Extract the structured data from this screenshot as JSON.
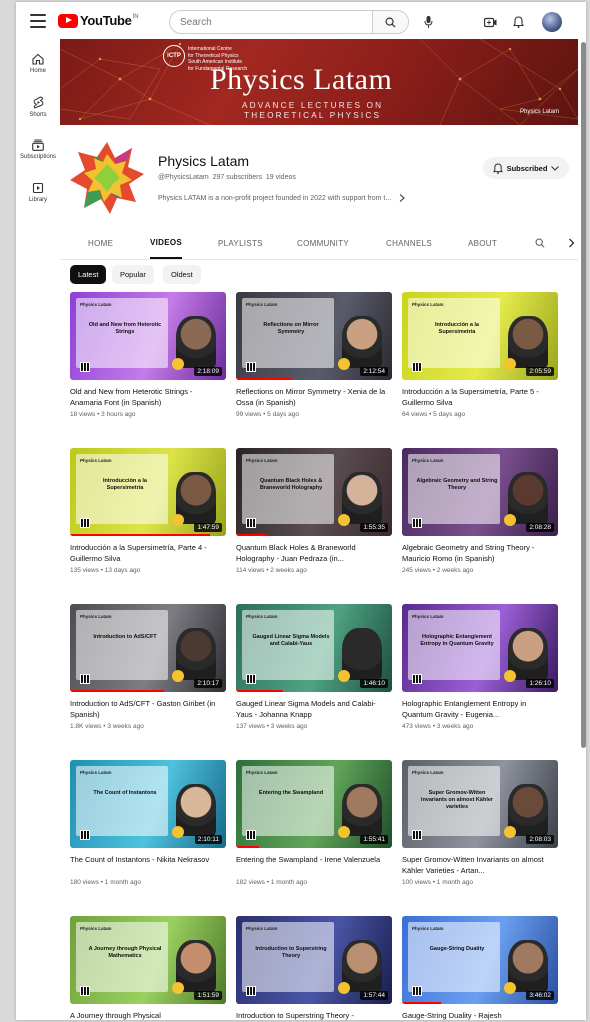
{
  "header": {
    "logo_text": "YouTube",
    "logo_region": "IN",
    "search_placeholder": "Search"
  },
  "sidebar": {
    "items": [
      {
        "label": "Home",
        "icon": "home-icon"
      },
      {
        "label": "Shorts",
        "icon": "shorts-icon"
      },
      {
        "label": "Subscriptions",
        "icon": "subscriptions-icon"
      },
      {
        "label": "Library",
        "icon": "library-icon"
      }
    ]
  },
  "banner": {
    "org_line1": "International Centre",
    "org_line2": "for Theoretical Physics",
    "org_line3": "South American Institute",
    "org_line4": "for Fundamental Research",
    "logo_text": "ICTP",
    "title": "Physics Latam",
    "subtitle_line1": "ADVANCE LECTURES ON",
    "subtitle_line2": "THEORETICAL PHYSICS",
    "badge": "Physics Latam"
  },
  "channel": {
    "name": "Physics Latam",
    "handle": "@PhysicsLatam",
    "subscribers": "297 subscribers",
    "videos_count": "19 videos",
    "description": "Physics LATAM is a non-profit project founded in 2022 with support from t...",
    "subscribe_label": "Subscribed"
  },
  "tabs": [
    "HOME",
    "VIDEOS",
    "PLAYLISTS",
    "COMMUNITY",
    "CHANNELS",
    "ABOUT"
  ],
  "active_tab": "VIDEOS",
  "chips": [
    "Latest",
    "Popular",
    "Oldest"
  ],
  "videos": [
    {
      "title": "Old and New from Heterotic Strings - Anamaria Font (in Spanish)",
      "meta": "18 views • 3 hours ago",
      "duration": "2:18:09",
      "thumb_title": "Old and New from Heterotic Strings"
    },
    {
      "title": "Reflections on Mirror Symmetry - Xenia de la Ossa (in Spanish)",
      "meta": "99 views • 5 days ago",
      "duration": "2:12:54",
      "thumb_title": "Reflections on Mirror Symmetry"
    },
    {
      "title": "Introducción a la Supersimetría, Parte 5 - Guillermo Silva",
      "meta": "64 views • 5 days ago",
      "duration": "2:05:59",
      "thumb_title": "Introducción a la Supersimetría"
    },
    {
      "title": "Introducción a la Supersimetría, Parte 4 - Guillermo Silva",
      "meta": "135 views • 13 days ago",
      "duration": "1:47:59",
      "thumb_title": "Introducción a la Supersimetría"
    },
    {
      "title": "Quantum Black Holes & Braneworld Holography - Juan Pedraza (in...",
      "meta": "114 views • 2 weeks ago",
      "duration": "1:55:35",
      "thumb_title": "Quantum Black Holes & Braneworld Holography"
    },
    {
      "title": "Algebraic Geometry and String Theory - Mauricio Romo (in Spanish)",
      "meta": "245 views • 2 weeks ago",
      "duration": "2:08:28",
      "thumb_title": "Algebraic Geometry and String Theory"
    },
    {
      "title": "Introduction to AdS/CFT - Gaston Giribet (in Spanish)",
      "meta": "1.8K views • 3 weeks ago",
      "duration": "2:10:17",
      "thumb_title": "Introduction to AdS/CFT"
    },
    {
      "title": "Gauged Linear Sigma Models and Calabi-Yaus - Johanna Knapp",
      "meta": "137 views • 3 weeks ago",
      "duration": "1:46:10",
      "thumb_title": "Gauged Linear Sigma Models and Calabi-Yaus"
    },
    {
      "title": "Holographic Entanglement Entropy in Quantum Gravity - Eugenia...",
      "meta": "473 views • 3 weeks ago",
      "duration": "1:26:10",
      "thumb_title": "Holographic Entanglement Entropy in Quantum Gravity"
    },
    {
      "title": "The Count of Instantons - Nikita Nekrasov",
      "meta": "180 views • 1 month ago",
      "duration": "2:10:11",
      "thumb_title": "The Count of Instantons"
    },
    {
      "title": "Entering the Swampland - Irene Valenzuela",
      "meta": "182 views • 1 month ago",
      "duration": "1:55:41",
      "thumb_title": "Entering the Swampland"
    },
    {
      "title": "Super Gromov-Witten Invariants on almost Kähler Varieties - Artan...",
      "meta": "100 views • 1 month ago",
      "duration": "2:08:03",
      "thumb_title": "Super Gromov-Witten invariants on almost Kähler varieties"
    },
    {
      "title": "A Journey through Physical",
      "meta": "",
      "duration": "1:51:59",
      "thumb_title": "A Journey through Physical Mathematics"
    },
    {
      "title": "Introduction to Superstring Theory -",
      "meta": "",
      "duration": "1:57:44",
      "thumb_title": "Introduction to Superstring Theory"
    },
    {
      "title": "Gauge-String Duality - Rajesh",
      "meta": "",
      "duration": "3:46:02",
      "thumb_title": "Gauge-String Duality"
    }
  ],
  "colors": {
    "brand_red": "#ff0000",
    "banner_red": "#a22820",
    "active_chip": "#0f0f0f"
  }
}
